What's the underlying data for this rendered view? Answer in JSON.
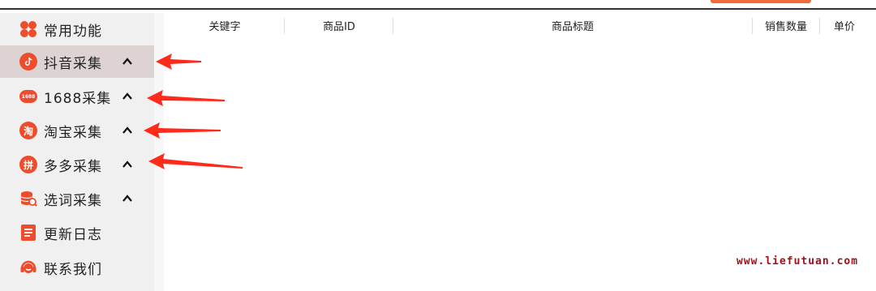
{
  "sidebar": {
    "items": [
      {
        "label": "常用功能",
        "icon": "grid-icon",
        "has_chevron": false,
        "active": false
      },
      {
        "label": "抖音采集",
        "icon": "douyin-icon",
        "has_chevron": true,
        "active": true
      },
      {
        "label": "1688采集",
        "icon": "alibaba-1688-icon",
        "icon_text": "1688",
        "has_chevron": true,
        "active": false
      },
      {
        "label": "淘宝采集",
        "icon": "taobao-icon",
        "icon_text": "淘",
        "has_chevron": true,
        "active": false
      },
      {
        "label": "多多采集",
        "icon": "pinduoduo-icon",
        "icon_text": "拼",
        "has_chevron": true,
        "active": false
      },
      {
        "label": "选词采集",
        "icon": "database-search-icon",
        "has_chevron": true,
        "active": false
      },
      {
        "label": "更新日志",
        "icon": "log-icon",
        "has_chevron": false,
        "active": false
      },
      {
        "label": "联系我们",
        "icon": "headset-icon",
        "has_chevron": false,
        "active": false
      }
    ]
  },
  "table": {
    "columns": [
      "关键字",
      "商品ID",
      "商品标题",
      "销售数量",
      "单价"
    ],
    "rows": []
  },
  "watermark": "www.liefutuan.com",
  "colors": {
    "accent": "#ee4d2d",
    "arrow": "#ff2a1a",
    "sidebar_bg": "#f0f0f0",
    "active_bg": "#ddd3d3",
    "watermark": "#a0121b"
  }
}
